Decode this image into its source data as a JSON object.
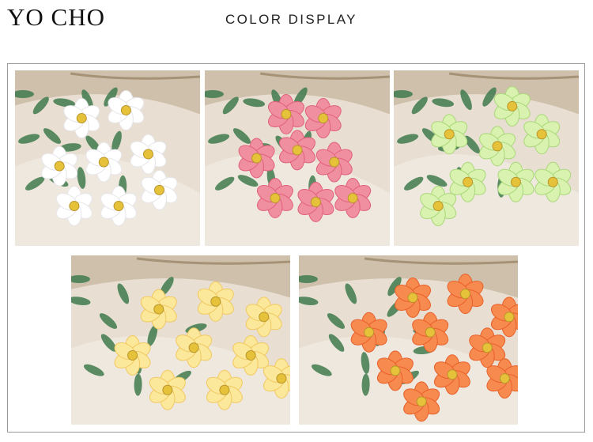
{
  "header": {
    "brand": "YO CHO",
    "section_title": "COLOR DISPLAY"
  },
  "photos": [
    {
      "petal": "#ffffff",
      "petal_edge": "#e6e6ea"
    },
    {
      "petal": "#f08fa0",
      "petal_edge": "#e0607a"
    },
    {
      "petal": "#d9f2b0",
      "petal_edge": "#a9d878"
    },
    {
      "petal": "#fbe89a",
      "petal_edge": "#f2c860"
    },
    {
      "petal": "#f78a4e",
      "petal_edge": "#e8602a"
    }
  ]
}
